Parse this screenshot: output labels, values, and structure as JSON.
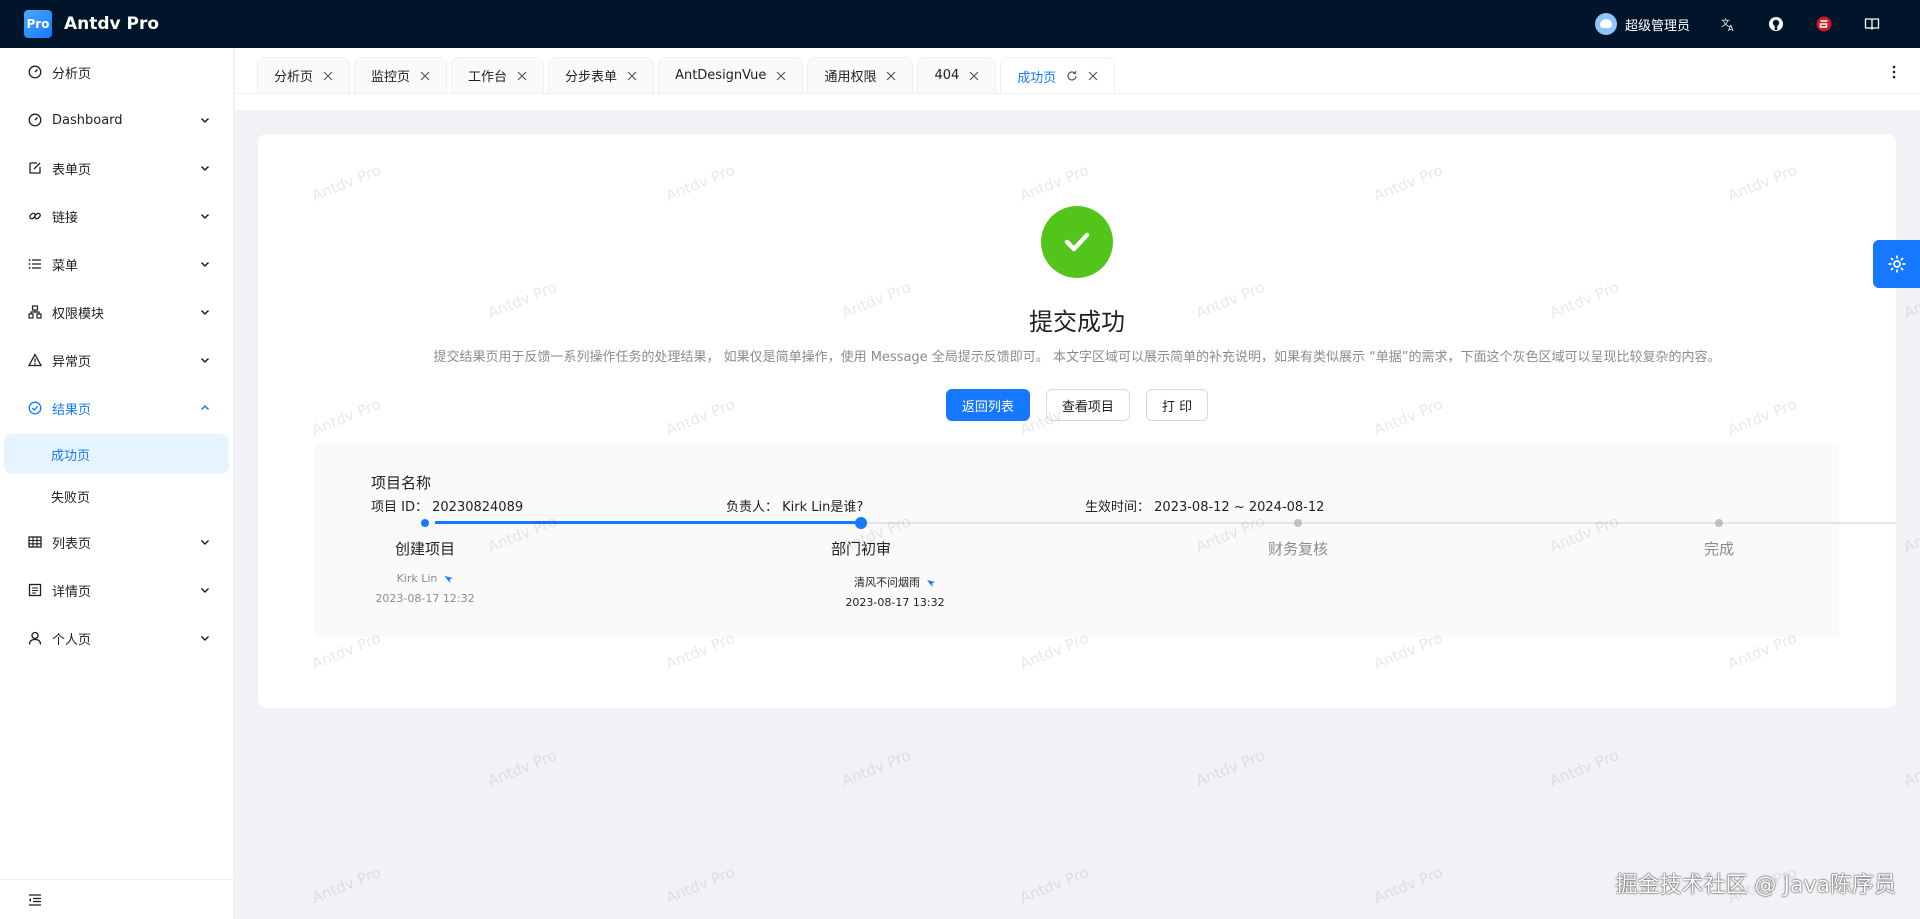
{
  "header": {
    "logo_text": "Pro",
    "app_title": "Antdv Pro",
    "user_name": "超级管理员",
    "translate_icon": "translate-icon",
    "github_icon": "github-icon",
    "gitee_icon": "gitee-icon",
    "docs_icon": "book-icon"
  },
  "sidebar": {
    "items": [
      {
        "label": "分析页",
        "icon": "dashboard-icon"
      },
      {
        "label": "Dashboard",
        "icon": "dashboard-icon"
      },
      {
        "label": "表单页",
        "icon": "form-icon"
      },
      {
        "label": "链接",
        "icon": "link-icon"
      },
      {
        "label": "菜单",
        "icon": "menu-icon"
      },
      {
        "label": "权限模块",
        "icon": "cluster-icon"
      },
      {
        "label": "异常页",
        "icon": "warning-icon"
      },
      {
        "label": "结果页",
        "icon": "check-circle-icon"
      },
      {
        "label": "列表页",
        "icon": "table-icon"
      },
      {
        "label": "详情页",
        "icon": "profile-icon"
      },
      {
        "label": "个人页",
        "icon": "user-icon"
      }
    ],
    "sub_items": [
      {
        "label": "成功页"
      },
      {
        "label": "失败页"
      }
    ]
  },
  "tabs": [
    {
      "label": "分析页"
    },
    {
      "label": "监控页"
    },
    {
      "label": "工作台"
    },
    {
      "label": "分步表单"
    },
    {
      "label": "AntDesignVue"
    },
    {
      "label": "通用权限"
    },
    {
      "label": "404"
    },
    {
      "label": "成功页"
    }
  ],
  "result": {
    "title": "提交成功",
    "subtitle": "提交结果页用于反馈一系列操作任务的处理结果， 如果仅是简单操作，使用 Message 全局提示反馈即可。 本文字区域可以展示简单的补充说明，如果有类似展示 “单据”的需求，下面这个灰色区域可以呈现比较复杂的内容。",
    "buttons": {
      "back": "返回列表",
      "view": "查看项目",
      "print": "打 印"
    }
  },
  "project": {
    "title": "项目名称",
    "id_label": "项目 ID：",
    "id_value": "20230824089",
    "owner_label": "负责人：",
    "owner_value": "Kirk Lin是谁?",
    "time_label": "生效时间：",
    "time_value": "2023-08-12 ~ 2024-08-12"
  },
  "steps": [
    {
      "title": "创建项目",
      "person": "Kirk Lin",
      "time": "2023-08-17 12:32"
    },
    {
      "title": "部门初审",
      "person": "清风不问烟雨",
      "time": "2023-08-17 13:32"
    },
    {
      "title": "财务复核"
    },
    {
      "title": "完成"
    }
  ],
  "watermark_text": "Antdv Pro",
  "credit": "掘金技术社区 @ Java陈序员",
  "colors": {
    "primary": "#1677ff",
    "success": "#52c41a",
    "header_bg": "#001529"
  }
}
